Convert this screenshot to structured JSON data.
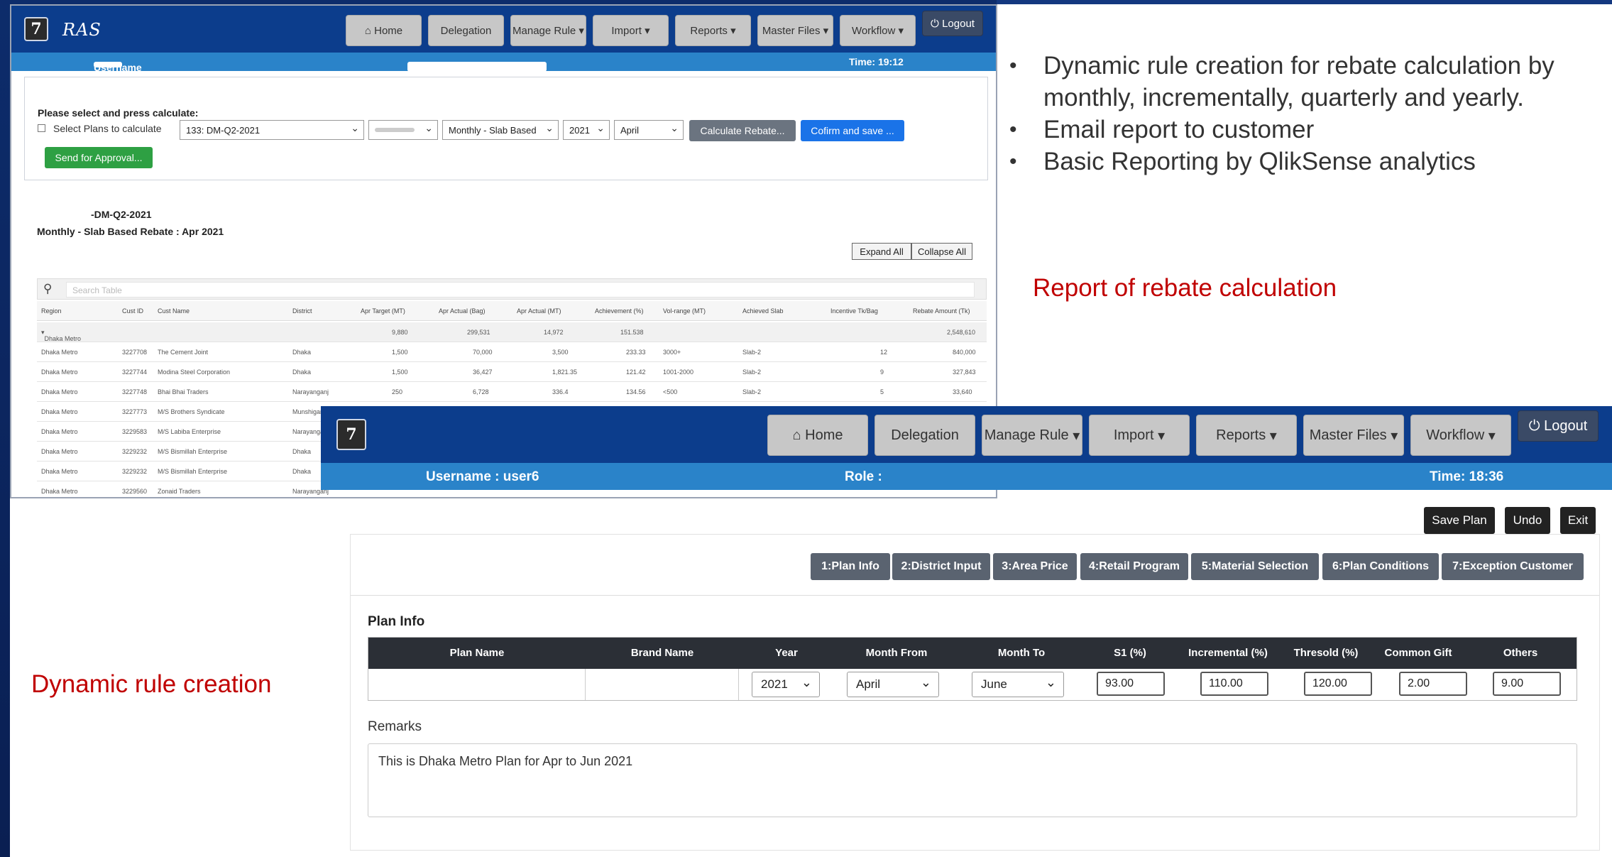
{
  "top_app": {
    "brand": "RAS",
    "nav": [
      "Home",
      "Delegation",
      "Manage Rule",
      "Import",
      "Reports",
      "Master Files",
      "Workflow",
      "Logout"
    ],
    "username_label": "Username :",
    "role_label": "Role :",
    "time_label": "Time: 19:12",
    "prompt": "Please select and press calculate:",
    "select_plans_label": "Select Plans to calculate",
    "plan_select": "133:            DM-Q2-2021",
    "area_select": "",
    "type_select": "Monthly - Slab Based",
    "year_select": "2021",
    "month_select": "April",
    "calc_button": "Calculate Rebate...",
    "save_button": "Cofirm and save ...",
    "approval_button": "Send for Approval...",
    "report_title1": "-DM-Q2-2021",
    "report_title2": "Monthly - Slab Based Rebate : Apr 2021",
    "expand_all": "Expand All",
    "collapse_all": "Collapse All",
    "search_placeholder": "Search Table",
    "columns": [
      "Region",
      "Cust ID",
      "Cust Name",
      "District",
      "Apr Target (MT)",
      "Apr Actual (Bag)",
      "Apr Actual (MT)",
      "Achievement (%)",
      "Vol-range (MT)",
      "Achieved Slab",
      "Incentive Tk/Bag",
      "Rebate Amount (Tk)"
    ],
    "group_row": {
      "region": "Dhaka Metro",
      "target": "9,880",
      "actual_bag": "299,531",
      "actual_mt": "14,972",
      "achievement": "151.538",
      "rebate": "2,548,610"
    },
    "rows": [
      {
        "region": "Dhaka Metro",
        "id": "3227708",
        "name": "The Cement Joint",
        "district": "Dhaka",
        "target": "1,500",
        "bag": "70,000",
        "mt": "3,500",
        "ach": "233.33",
        "range": "3000+",
        "slab": "Slab-2",
        "inc": "12",
        "rebate": "840,000"
      },
      {
        "region": "Dhaka Metro",
        "id": "3227744",
        "name": "Modina Steel Corporation",
        "district": "Dhaka",
        "target": "1,500",
        "bag": "36,427",
        "mt": "1,821.35",
        "ach": "121.42",
        "range": "1001-2000",
        "slab": "Slab-2",
        "inc": "9",
        "rebate": "327,843"
      },
      {
        "region": "Dhaka Metro",
        "id": "3227748",
        "name": "Bhai Bhai Traders",
        "district": "Narayanganj",
        "target": "250",
        "bag": "6,728",
        "mt": "336.4",
        "ach": "134.56",
        "range": "<500",
        "slab": "Slab-2",
        "inc": "5",
        "rebate": "33,640"
      },
      {
        "region": "Dhaka Metro",
        "id": "3227773",
        "name": "M/S Brothers Syndicate",
        "district": "Munshiganj",
        "target": "",
        "bag": "",
        "mt": "",
        "ach": "",
        "range": "",
        "slab": "",
        "inc": "",
        "rebate": ""
      },
      {
        "region": "Dhaka Metro",
        "id": "3229583",
        "name": "M/S Labiba Enterprise",
        "district": "Narayanganj",
        "target": "",
        "bag": "",
        "mt": "",
        "ach": "",
        "range": "",
        "slab": "",
        "inc": "",
        "rebate": ""
      },
      {
        "region": "Dhaka Metro",
        "id": "3229232",
        "name": "M/S Bismillah Enterprise",
        "district": "Dhaka",
        "target": "",
        "bag": "",
        "mt": "",
        "ach": "",
        "range": "",
        "slab": "",
        "inc": "",
        "rebate": ""
      },
      {
        "region": "Dhaka Metro",
        "id": "3229232",
        "name": "M/S Bismillah Enterprise",
        "district": "Dhaka",
        "target": "",
        "bag": "",
        "mt": "",
        "ach": "",
        "range": "",
        "slab": "",
        "inc": "",
        "rebate": ""
      },
      {
        "region": "Dhaka Metro",
        "id": "3229560",
        "name": "Zonaid Traders",
        "district": "Narayanganj",
        "target": "",
        "bag": "",
        "mt": "",
        "ach": "",
        "range": "",
        "slab": "",
        "inc": "",
        "rebate": ""
      }
    ]
  },
  "bullets": [
    "Dynamic rule creation for rebate calculation by monthly, incrementally, quarterly and yearly.",
    "Email report to customer",
    "Basic Reporting by QlikSense analytics"
  ],
  "caption_report": "Report of rebate calculation",
  "caption_rule": "Dynamic rule creation",
  "bottom_app": {
    "nav": [
      "Home",
      "Delegation",
      "Manage Rule",
      "Import",
      "Reports",
      "Master Files",
      "Workflow",
      "Logout"
    ],
    "username": "Username : user6",
    "role": "Role :",
    "time": "Time: 18:36",
    "save_plan": "Save Plan",
    "undo": "Undo",
    "exit": "Exit",
    "tabs": [
      "1:Plan Info",
      "2:District Input",
      "3:Area Price",
      "4:Retail Program",
      "5:Material Selection",
      "6:Plan Conditions",
      "7:Exception Customer"
    ],
    "plan_info_title": "Plan Info",
    "columns": [
      "Plan Name",
      "Brand Name",
      "Year",
      "Month From",
      "Month To",
      "S1 (%)",
      "Incremental (%)",
      "Thresold (%)",
      "Common Gift",
      "Others"
    ],
    "year": "2021",
    "month_from": "April",
    "month_to": "June",
    "s1": "93.00",
    "incremental": "110.00",
    "threshold": "120.00",
    "common_gift": "2.00",
    "others": "9.00",
    "remarks_label": "Remarks",
    "remarks": "This is Dhaka Metro Plan for Apr to Jun 2021"
  },
  "colors": {
    "nav": "#0c3d8c",
    "infobar": "#2a83c9",
    "caption": "#c00000",
    "frame": "#0d2c6b"
  }
}
